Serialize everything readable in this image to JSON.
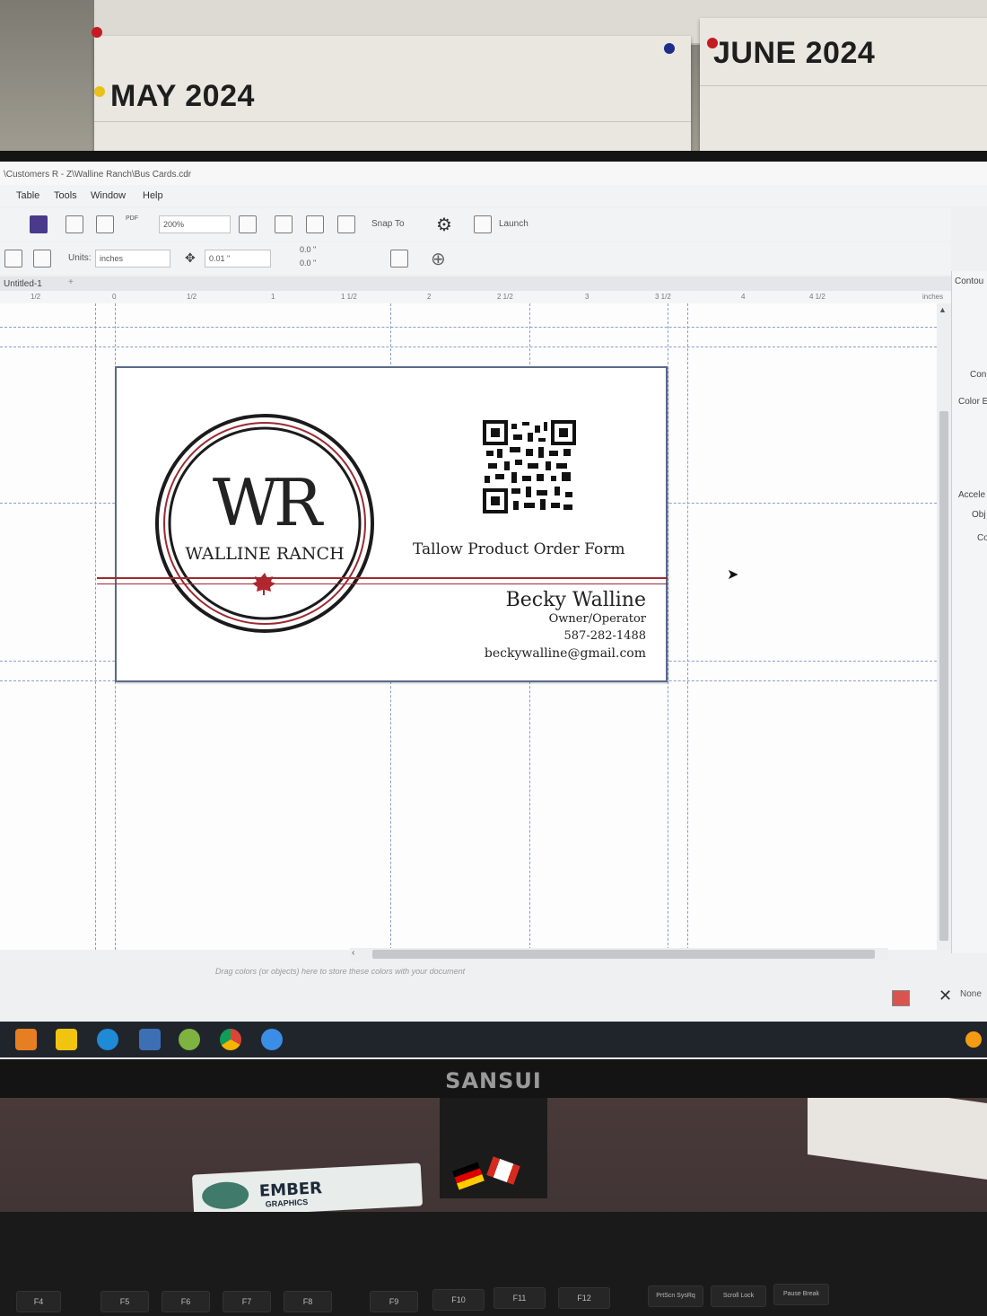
{
  "wall": {
    "calendar_left": "MAY 2024",
    "calendar_right": "JUNE 2024"
  },
  "window": {
    "title": "\\Customers R - Z\\Walline Ranch\\Bus Cards.cdr"
  },
  "menu": {
    "items": [
      "Table",
      "Tools",
      "Window",
      "Help"
    ]
  },
  "toolbar": {
    "zoom": "200%",
    "snap_label": "Snap To",
    "launch_label": "Launch",
    "units_label": "Units:",
    "units_value": "inches",
    "nudge_value": "0.01 \"",
    "dup_x": "0.0 \"",
    "dup_y": "0.0 \""
  },
  "tabs": {
    "document": "Untitled-1"
  },
  "ruler": {
    "marks": [
      "1/2",
      "0",
      "1/2",
      "1",
      "1 1/2",
      "2",
      "2 1/2",
      "3",
      "3 1/2",
      "4",
      "4 1/2",
      "inches"
    ]
  },
  "docker": {
    "labels": [
      "Contou",
      "Con",
      "Color E",
      "Accele",
      "Obj",
      "Co"
    ]
  },
  "card": {
    "logo_initials": "WR",
    "logo_name": "WALLINE RANCH",
    "qr_caption": "Tallow Product Order Form",
    "person_name": "Becky Walline",
    "role": "Owner/Operator",
    "phone": "587-282-1488",
    "email": "beckywalline@gmail.com",
    "accent_color": "#9c2a30"
  },
  "palette": {
    "hint": "Drag colors (or objects) here to store these colors with your document",
    "fill_none": "None"
  },
  "monitor": {
    "brand": "SANSUI"
  },
  "desk": {
    "sticker": "EMBER",
    "sticker_sub": "GRAPHICS"
  },
  "keyboard": {
    "keys": [
      "F4",
      "F5",
      "F6",
      "F7",
      "F8",
      "F9",
      "F10",
      "F11",
      "F12",
      "PrtScn SysRq",
      "Scroll Lock",
      "Pause Break"
    ]
  }
}
